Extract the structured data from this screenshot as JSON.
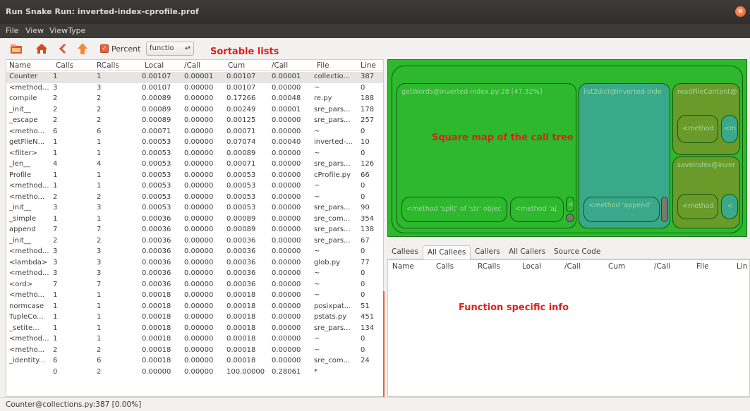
{
  "window": {
    "title": "Run Snake Run: inverted-index-cprofile.prof"
  },
  "menu": [
    "File",
    "View",
    "ViewType"
  ],
  "toolbar": {
    "percent_label": "Percent",
    "combo_value": "functio"
  },
  "annotations": {
    "sortable": "Sortable lists",
    "squaremap": "Square map of the call tree",
    "function_info": "Function specific info"
  },
  "table": {
    "headers": [
      "Name",
      "Calls",
      "RCalls",
      "Local",
      "/Call",
      "Cum",
      "/Call",
      "File",
      "Line"
    ],
    "rows": [
      [
        "Counter",
        "1",
        "1",
        "0.00107",
        "0.00001",
        "0.00107",
        "0.00001",
        "collectio...",
        "387"
      ],
      [
        "<method...",
        "3",
        "3",
        "0.00107",
        "0.00000",
        "0.00107",
        "0.00000",
        "~",
        "0"
      ],
      [
        "compile",
        "2",
        "2",
        "0.00089",
        "0.00000",
        "0.17266",
        "0.00048",
        "re.py",
        "188"
      ],
      [
        "_init__",
        "2",
        "2",
        "0.00089",
        "0.00000",
        "0.00249",
        "0.00001",
        "sre_pars...",
        "178"
      ],
      [
        "_escape",
        "2",
        "2",
        "0.00089",
        "0.00000",
        "0.00125",
        "0.00000",
        "sre_pars...",
        "257"
      ],
      [
        "<metho...",
        "6",
        "6",
        "0.00071",
        "0.00000",
        "0.00071",
        "0.00000",
        "~",
        "0"
      ],
      [
        "getFileN...",
        "1",
        "1",
        "0.00053",
        "0.00000",
        "0.07074",
        "0.00040",
        "inverted-...",
        "10"
      ],
      [
        "<filter>",
        "1",
        "1",
        "0.00053",
        "0.00000",
        "0.00089",
        "0.00000",
        "~",
        "0"
      ],
      [
        "_len__",
        "4",
        "4",
        "0.00053",
        "0.00000",
        "0.00071",
        "0.00000",
        "sre_pars...",
        "126"
      ],
      [
        "Profile",
        "1",
        "1",
        "0.00053",
        "0.00000",
        "0.00053",
        "0.00000",
        "cProfile.py",
        "66"
      ],
      [
        "<method...",
        "1",
        "1",
        "0.00053",
        "0.00000",
        "0.00053",
        "0.00000",
        "~",
        "0"
      ],
      [
        "<metho...",
        "2",
        "2",
        "0.00053",
        "0.00000",
        "0.00053",
        "0.00000",
        "~",
        "0"
      ],
      [
        "_init__",
        "3",
        "3",
        "0.00053",
        "0.00000",
        "0.00053",
        "0.00000",
        "sre_pars...",
        "90"
      ],
      [
        "_simple",
        "1",
        "1",
        "0.00036",
        "0.00000",
        "0.00089",
        "0.00000",
        "sre_com...",
        "354"
      ],
      [
        "append",
        "7",
        "7",
        "0.00036",
        "0.00000",
        "0.00089",
        "0.00000",
        "sre_pars...",
        "138"
      ],
      [
        "_init__",
        "2",
        "2",
        "0.00036",
        "0.00000",
        "0.00036",
        "0.00000",
        "sre_pars...",
        "67"
      ],
      [
        "<method...",
        "3",
        "3",
        "0.00036",
        "0.00000",
        "0.00036",
        "0.00000",
        "~",
        "0"
      ],
      [
        "<lambda>",
        "3",
        "3",
        "0.00036",
        "0.00000",
        "0.00036",
        "0.00000",
        "glob.py",
        "77"
      ],
      [
        "<method...",
        "3",
        "3",
        "0.00036",
        "0.00000",
        "0.00036",
        "0.00000",
        "~",
        "0"
      ],
      [
        "<ord>",
        "7",
        "7",
        "0.00036",
        "0.00000",
        "0.00036",
        "0.00000",
        "~",
        "0"
      ],
      [
        "<metho...",
        "1",
        "1",
        "0.00018",
        "0.00000",
        "0.00018",
        "0.00000",
        "~",
        "0"
      ],
      [
        "normcase",
        "1",
        "1",
        "0.00018",
        "0.00000",
        "0.00018",
        "0.00000",
        "posixpat...",
        "51"
      ],
      [
        "TupleCo...",
        "1",
        "1",
        "0.00018",
        "0.00000",
        "0.00018",
        "0.00000",
        "pstats.py",
        "451"
      ],
      [
        "_setite...",
        "1",
        "1",
        "0.00018",
        "0.00000",
        "0.00018",
        "0.00000",
        "sre_pars...",
        "134"
      ],
      [
        "<method...",
        "1",
        "1",
        "0.00018",
        "0.00000",
        "0.00018",
        "0.00000",
        "~",
        "0"
      ],
      [
        "<metho...",
        "2",
        "2",
        "0.00018",
        "0.00000",
        "0.00018",
        "0.00000",
        "~",
        "0"
      ],
      [
        "_identity...",
        "6",
        "6",
        "0.00018",
        "0.00000",
        "0.00018",
        "0.00000",
        "sre_com...",
        "24"
      ],
      [
        "",
        "0",
        "2",
        "0.00000",
        "0.00000",
        "100.00000",
        "0.28061",
        "*",
        ""
      ]
    ]
  },
  "squaremap": {
    "get_words": "getWords@inverted-index.py:28 [47.32%]",
    "list2dict": "list2dict@inverted-inde",
    "read_file": "readFileContent@",
    "method_a": "<method",
    "method_m": "<m",
    "save_index": "saveIndex@inver",
    "method_split": "<method 'split' of 'str' objec",
    "method_aj": "<method 'aj",
    "method_dot": "<",
    "method_append": "<method 'append'",
    "method_b": "<method",
    "method_c": "<"
  },
  "tabs": [
    "Callees",
    "All Callees",
    "Callers",
    "All Callers",
    "Source Code"
  ],
  "detail_headers": [
    "Name",
    "Calls",
    "RCalls",
    "Local",
    "/Call",
    "Cum",
    "/Call",
    "File",
    "Lin"
  ],
  "status": "Counter@collections.py:387 [0.00%]",
  "colors": {
    "map_green": "#2db82d",
    "map_teal": "#3aa88a",
    "map_olive": "#6a9a2a",
    "accent": "#e8643a"
  }
}
